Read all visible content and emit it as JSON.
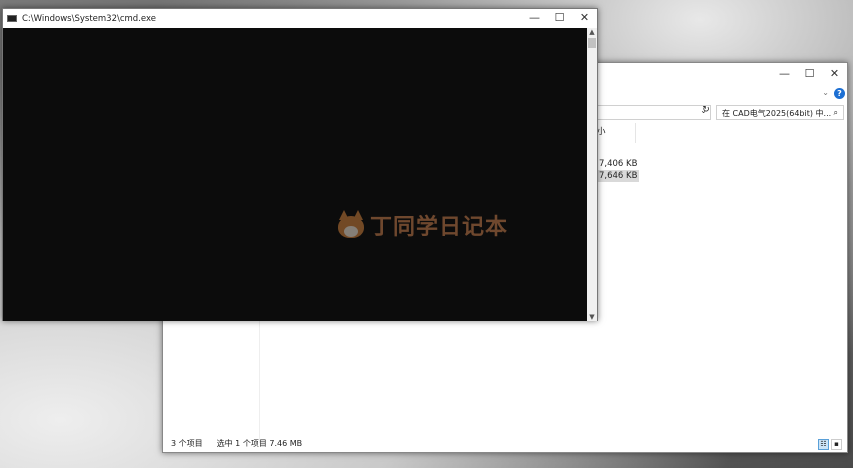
{
  "cmd": {
    "title": "C:\\Windows\\System32\\cmd.exe"
  },
  "window_controls": {
    "minimize": "—",
    "maximize": "☐",
    "close": "✕"
  },
  "explorer": {
    "search_placeholder": "在 CAD电气2025(64bit) 中...",
    "search_icon": "⌕",
    "refresh_icon": "↻",
    "dropdown_icon": "⌄",
    "help_icon": "?",
    "expand_icon": "⌄",
    "column_size": "小",
    "rows": [
      {
        "size": "7,406 KB",
        "selected": false
      },
      {
        "size": "7,646 KB",
        "selected": true
      }
    ],
    "status": {
      "count": "3 个项目",
      "selection": "选中 1 个项目  7.46 MB"
    },
    "view_details_icon": "☷",
    "view_tiles_icon": "▪"
  },
  "watermark": {
    "text": "丁同学日记本"
  },
  "colors": {
    "console_bg": "#0c0c0c",
    "help_blue": "#1c6fd3",
    "watermark": "#c0794a"
  }
}
